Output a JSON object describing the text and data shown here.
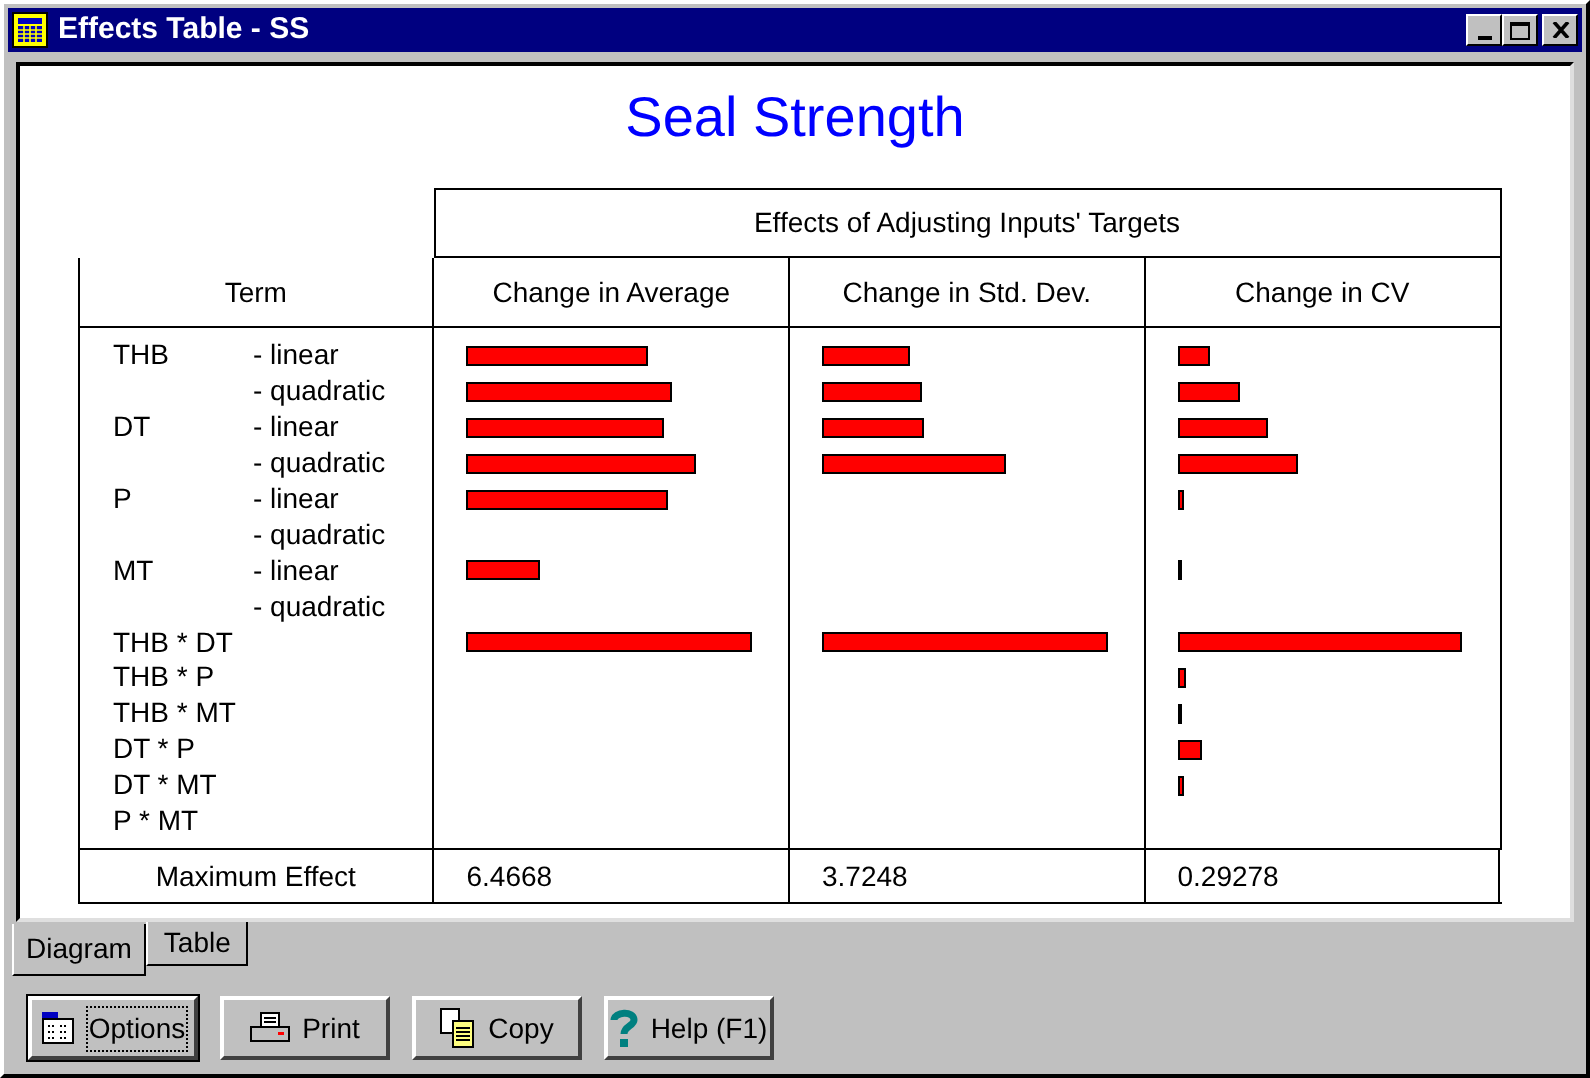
{
  "window": {
    "title": "Effects Table - SS"
  },
  "chart_title": "Seal Strength",
  "group_header": "Effects of Adjusting Inputs' Targets",
  "columns": [
    "Term",
    "Change in Average",
    "Change in Std. Dev.",
    "Change in CV"
  ],
  "rows": [
    {
      "term": "THB",
      "qualifier": "- linear",
      "average": true,
      "std_dev": true,
      "cv": true
    },
    {
      "qualifier": "- quadratic",
      "average": true,
      "std_dev": true,
      "cv": true
    },
    {
      "term": "DT",
      "qualifier": "- linear",
      "average": true,
      "std_dev": true,
      "cv": true
    },
    {
      "qualifier": "- quadratic",
      "average": true,
      "std_dev": true,
      "cv": true
    },
    {
      "term": "P",
      "qualifier": "- linear",
      "average": true,
      "cv": true
    },
    {
      "qualifier": "- quadratic"
    },
    {
      "term": "MT",
      "qualifier": "- linear",
      "average": true,
      "cv": true
    },
    {
      "qualifier": "- quadratic"
    },
    {
      "term": "THB * DT",
      "average": true,
      "std_dev": true,
      "cv": true
    },
    {
      "term": "THB * P",
      "cv": true
    },
    {
      "term": "THB * MT",
      "cv": true
    },
    {
      "term": "DT * P",
      "cv": true
    },
    {
      "term": "DT * MT",
      "cv": true
    },
    {
      "term": "P * MT"
    }
  ],
  "footer": {
    "label": "Maximum Effect",
    "values": [
      "6.4668",
      "3.7248",
      "0.29278"
    ]
  },
  "tabs": [
    {
      "label": "Diagram",
      "selected": true
    },
    {
      "label": "Table",
      "selected": false
    }
  ],
  "buttons": [
    {
      "label": "Options",
      "kind": "options",
      "focused": true
    },
    {
      "label": "Print",
      "kind": "print",
      "focused": false
    },
    {
      "label": "Copy",
      "kind": "copy",
      "focused": false
    },
    {
      "label": "Help (F1)",
      "kind": "help",
      "focused": false
    }
  ]
}
